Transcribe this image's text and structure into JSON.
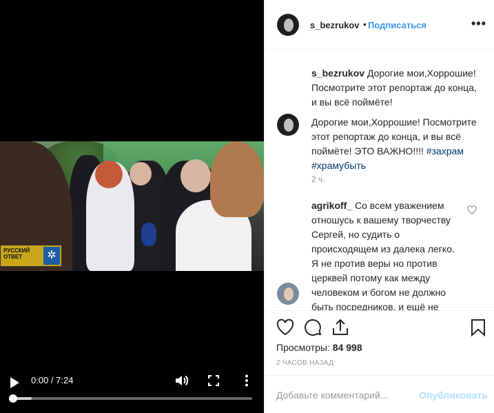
{
  "video": {
    "time_display": "0:00 / 7:24",
    "progress_fraction": 0.0,
    "buffered_fraction": 0.08,
    "logo_text": "РУССКИЙ ОТВЕТ",
    "icons": [
      "play-icon",
      "volume-icon",
      "fullscreen-icon",
      "more-vert-icon"
    ]
  },
  "header": {
    "username": "s_bezrukov",
    "separator": "•",
    "follow_label": "Подписаться",
    "more_label": "•••"
  },
  "caption": {
    "username": "s_bezrukov",
    "text": "Дорогие мои,Хоррошие! Посмотрите этот репортаж до конца, и вы всё поймёте!"
  },
  "comment_author_post": {
    "text": "Дорогие мои,Хоррошие! Посмотрите этот репортаж до конца, и вы всё поймёте! ЭТО ВАЖНО!!!! ",
    "hashtags": "#захрам #храмубыть",
    "time": "2 ч."
  },
  "comment_reply": {
    "username": "agrikoff_",
    "text": "Со всем уважением отношусь к вашему творчеству Сергей, но судить о происходящем из далека легко. Я не против веры но против церквей потому как между человеком и богом не должно быть посредников, и ещё не молаважный вопрос зачем"
  },
  "footer": {
    "views_label": "Просмотры:",
    "views_count": "84 998",
    "timestamp": "2 ЧАСОВ НАЗАД",
    "comment_placeholder": "Добавьте комментарий...",
    "post_label": "Опубликовать"
  },
  "colors": {
    "link": "#3897f0",
    "post_disabled": "#b2dffc",
    "muted": "#999999",
    "text": "#262626"
  }
}
